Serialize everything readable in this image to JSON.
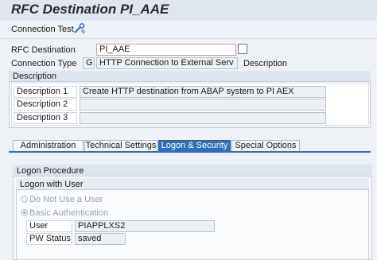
{
  "window": {
    "title": "RFC Destination PI_AAE"
  },
  "toolbar": {
    "connection_test": "Connection Test",
    "icon": "wrench-icon"
  },
  "header": {
    "rfc_destination_label": "RFC Destination",
    "rfc_destination_value": "PI_AAE",
    "connection_type_label": "Connection Type",
    "connection_type_code": "G",
    "connection_type_text": "HTTP Connection to External Serv",
    "description_label": "Description"
  },
  "description_group": {
    "title": "Description",
    "rows": [
      {
        "label": "Description 1",
        "value": "Create HTTP destination from ABAP system to PI AEX"
      },
      {
        "label": "Description 2",
        "value": ""
      },
      {
        "label": "Description 3",
        "value": ""
      }
    ]
  },
  "tabs": [
    {
      "label": "Administration"
    },
    {
      "label": "Technical Settings"
    },
    {
      "label": "Logon & Security"
    },
    {
      "label": "Special Options"
    }
  ],
  "active_tab": "Logon & Security",
  "logon": {
    "group_title": "Logon Procedure",
    "subgroup_title": "Logon with User",
    "options": [
      {
        "label": "Do Not Use a User",
        "selected": false
      },
      {
        "label": "Basic Authentication",
        "selected": true
      }
    ],
    "user_label": "User",
    "user_value": "PIAPPLXS2",
    "pw_status_label": "PW Status",
    "pw_status_value": "saved"
  }
}
